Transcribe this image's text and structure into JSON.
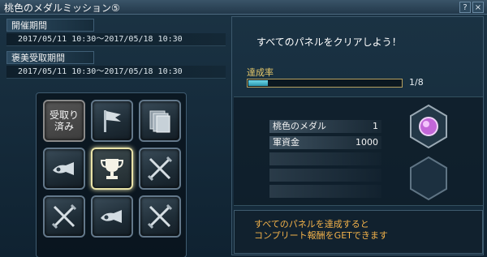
{
  "window": {
    "title": "桃色のメダルミッション⑤",
    "help_label": "?",
    "close_label": "×"
  },
  "periods": {
    "event_label": "開催期間",
    "event_value": "2017/05/11 10:30～2017/05/18 10:30",
    "reward_label": "褒美受取期間",
    "reward_value": "2017/05/11 10:30～2017/05/18 10:30"
  },
  "panels": [
    {
      "status": "claimed",
      "label": "受取り\n済み",
      "icon": "claimed-badge"
    },
    {
      "status": "locked",
      "icon": "flag-icon"
    },
    {
      "status": "locked",
      "icon": "cards-icon"
    },
    {
      "status": "locked",
      "icon": "horn-icon"
    },
    {
      "status": "selected",
      "icon": "trophy-icon"
    },
    {
      "status": "locked",
      "icon": "crossed-swords-icon"
    },
    {
      "status": "locked",
      "icon": "crossed-swords-icon"
    },
    {
      "status": "locked",
      "icon": "horn-icon"
    },
    {
      "status": "locked",
      "icon": "crossed-swords-icon"
    }
  ],
  "mission": {
    "text": "すべてのパネルをクリアしよう！",
    "rate_label": "達成率",
    "progress_fraction": 0.125,
    "count_text": "1/8"
  },
  "rewards": [
    {
      "name": "桃色のメダル",
      "qty": "1"
    },
    {
      "name": "軍資金",
      "qty": "1000"
    },
    {
      "name": "",
      "qty": ""
    },
    {
      "name": "",
      "qty": ""
    },
    {
      "name": "",
      "qty": ""
    }
  ],
  "complete": {
    "line1": "すべてのパネルを達成すると",
    "line2": "コンプリート報酬をGETできます"
  },
  "colors": {
    "accent_gold": "#e6c86a",
    "progress_cyan": "#4fc3d6",
    "complete_orange": "#f3b24a"
  }
}
